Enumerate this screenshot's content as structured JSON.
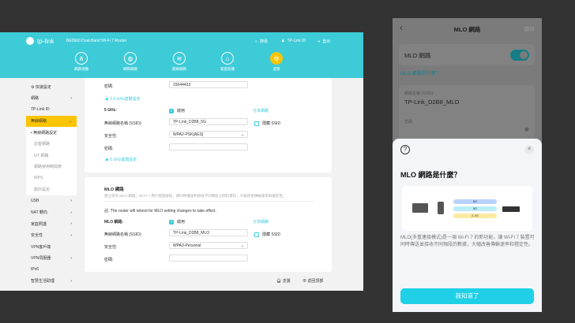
{
  "router": {
    "brand": "tp-link",
    "model": "BE3600 Dual-Band Wi-Fi 7 Router",
    "top_links": [
      "搜尋",
      "TP-Link ID",
      "登出"
    ],
    "nav": [
      "網路地圖",
      "網際網路",
      "無線網路",
      "家庭照護",
      "進階"
    ],
    "sidebar": [
      {
        "label": "快速設定",
        "arrow": ""
      },
      {
        "label": "網路",
        "arrow": "›"
      },
      {
        "label": "TP-Link ID",
        "arrow": ""
      },
      {
        "label": "無線網路",
        "arrow": "⌄"
      }
    ],
    "sidebar_sub": [
      "無線網路設定",
      "訪客網路",
      "IoT 網路",
      "網路使用時間表",
      "WPS",
      "額外設定"
    ],
    "sidebar_more": [
      {
        "label": "USB",
        "arrow": "›"
      },
      {
        "label": "NAT 轉向",
        "arrow": "›"
      },
      {
        "label": "家庭照護",
        "arrow": "›"
      },
      {
        "label": "安全性",
        "arrow": "›"
      },
      {
        "label": "VPN客戶端",
        "arrow": ""
      },
      {
        "label": "VPN伺服器",
        "arrow": "›"
      },
      {
        "label": "IPv6",
        "arrow": ""
      },
      {
        "label": "智慧生活助理",
        "arrow": "›"
      }
    ],
    "card1": {
      "pw_label": "密碼:",
      "pw_value": "15044433",
      "adv24": "2.4 GHz進階設定",
      "band": "5 GHz:",
      "enable": "啟用",
      "share": "分享網路",
      "ssid_label": "無線網路名稱 (SSID):",
      "ssid": "TP-Link_D2B8_5G",
      "hide": "隱藏 SSID",
      "sec_label": "安全性:",
      "sec": "WPA2-PSK[AES]",
      "pw2_label": "密碼:",
      "adv5": "5 GHz進階設定"
    },
    "card2": {
      "title": "MLO 網路",
      "desc": "建立您的 MLO 網路，Wi-Fi 7 用戶端連線後，將同時傳送和接收不同頻段之間的資料，大幅改善傳輸速率和穩定性。",
      "note": "註: The router will reboot for MLO setting changes to take effect.",
      "mlo_label": "MLO 網路:",
      "enable": "啟用",
      "share": "分享網路",
      "ssid_label": "無線網路名稱 (SSID):",
      "ssid": "TP-Link_D2B8_MLO",
      "hide": "隱藏 SSID",
      "sec_label": "安全性:",
      "sec": "WPA3-Personal",
      "pw_label": "密碼:"
    },
    "footer": {
      "support": "支援",
      "top": "返回頂部"
    }
  },
  "phone": {
    "title": "MLO 網路",
    "save": "儲存",
    "toggle_label": "MLO 網路",
    "toggle_on": true,
    "help_link": "MLO 網路是什麼？",
    "ssid_label": "網路名稱 (SSID)",
    "ssid": "TP-Link_D2B8_MLO",
    "pw_label": "密碼",
    "sheet": {
      "title": "MLO 網路是什麼？",
      "bands": [
        "6G",
        "5G",
        "2.4G"
      ],
      "body": "MLO(多重連接模式)是一項 Wi-Fi 7 的新功能，讓 Wi-Fi 7 裝置可同時傳送並接收不同頻段的數據，大幅改善傳輸速率和穩定性。",
      "ok": "我知道了"
    }
  }
}
